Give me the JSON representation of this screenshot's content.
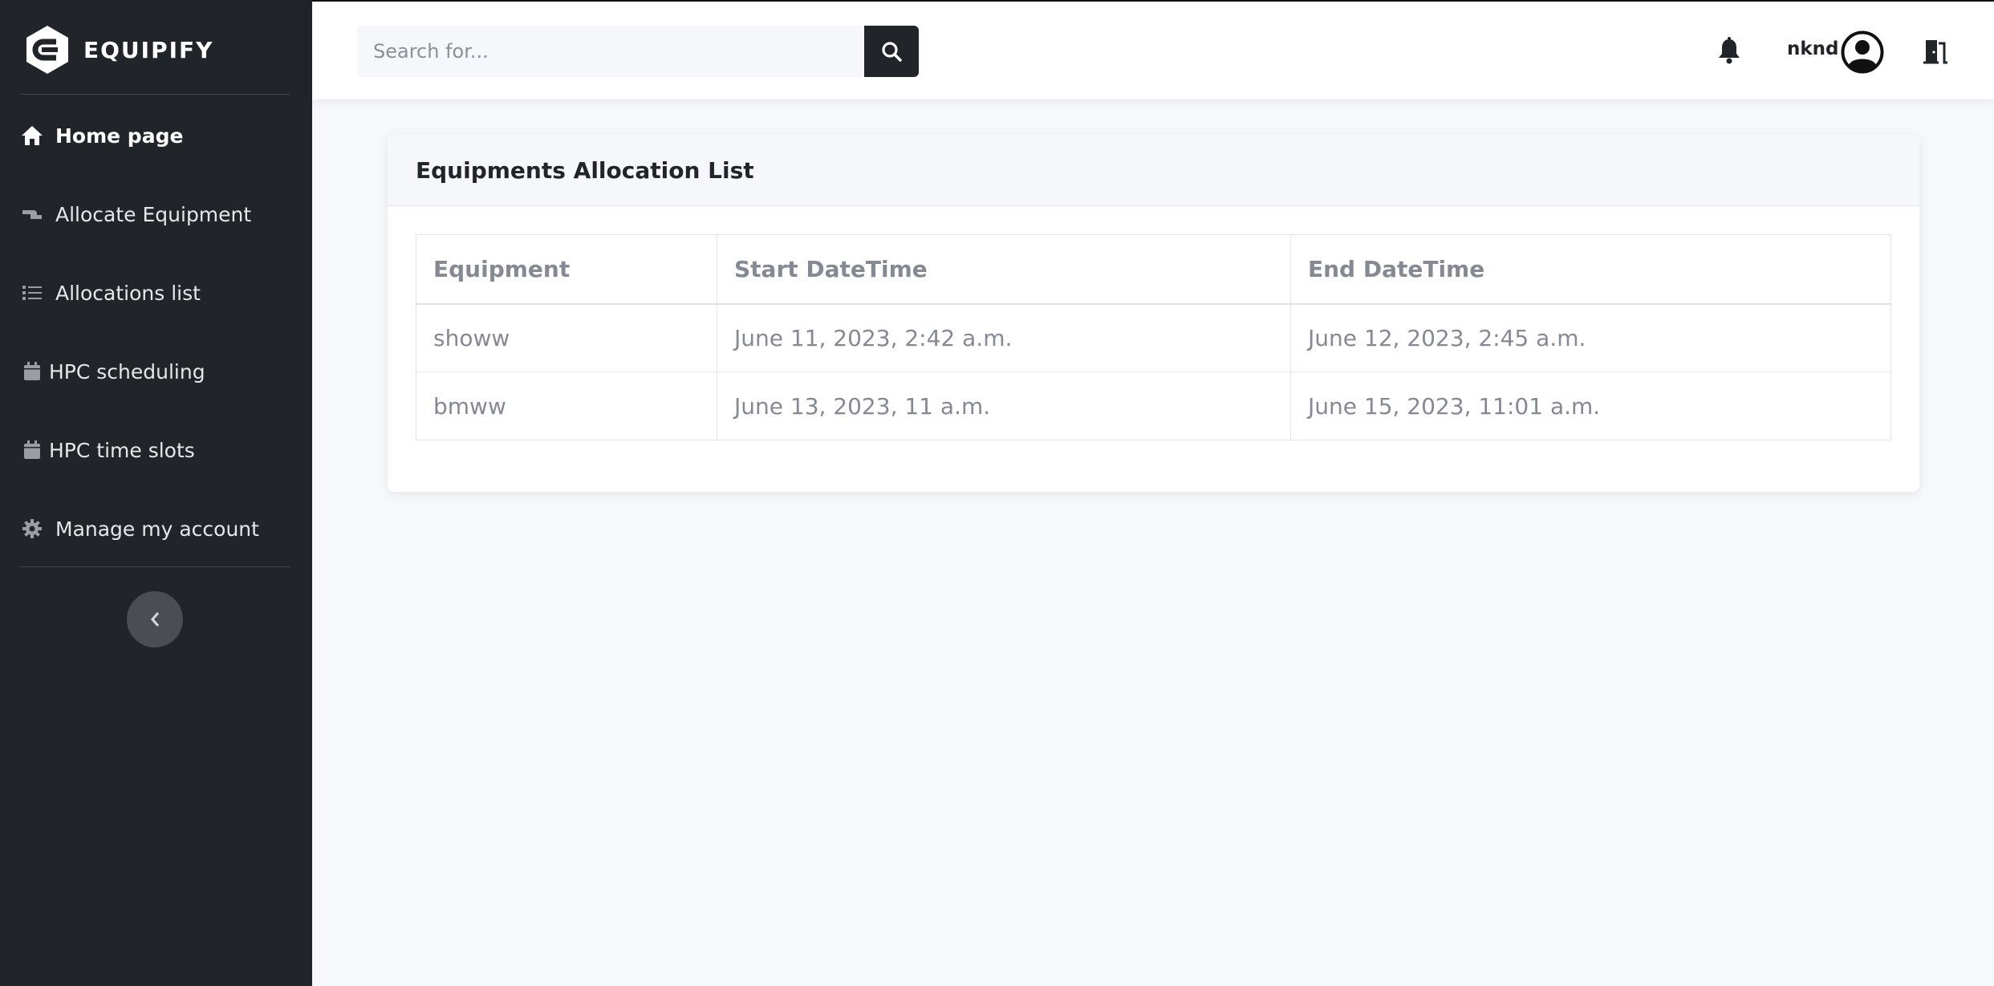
{
  "brand": {
    "name": "EQUIPIFY"
  },
  "sidebar": {
    "items": [
      {
        "label": "Home page",
        "icon": "home-icon"
      },
      {
        "label": "Allocate Equipment",
        "icon": "hand-holding-icon"
      },
      {
        "label": "Allocations list",
        "icon": "list-icon"
      },
      {
        "label": "HPC scheduling",
        "icon": "calendar-icon"
      },
      {
        "label": "HPC time slots",
        "icon": "calendar-icon"
      },
      {
        "label": "Manage my account",
        "icon": "gear-icon"
      }
    ],
    "collapse_icon": "chevron-left-icon"
  },
  "topbar": {
    "search": {
      "placeholder": "Search for...",
      "value": ""
    },
    "username": "nknd"
  },
  "card": {
    "title": "Equipments Allocation List",
    "columns": [
      "Equipment",
      "Start DateTime",
      "End DateTime"
    ],
    "rows": [
      [
        "showw",
        "June 11, 2023, 2:42 a.m.",
        "June 12, 2023, 2:45 a.m."
      ],
      [
        "bmww",
        "June 13, 2023, 11 a.m.",
        "June 15, 2023, 11:01 a.m."
      ]
    ]
  },
  "colors": {
    "sidebar_bg": "#212529",
    "page_bg": "#f7f8fc",
    "text_muted": "#858993"
  }
}
